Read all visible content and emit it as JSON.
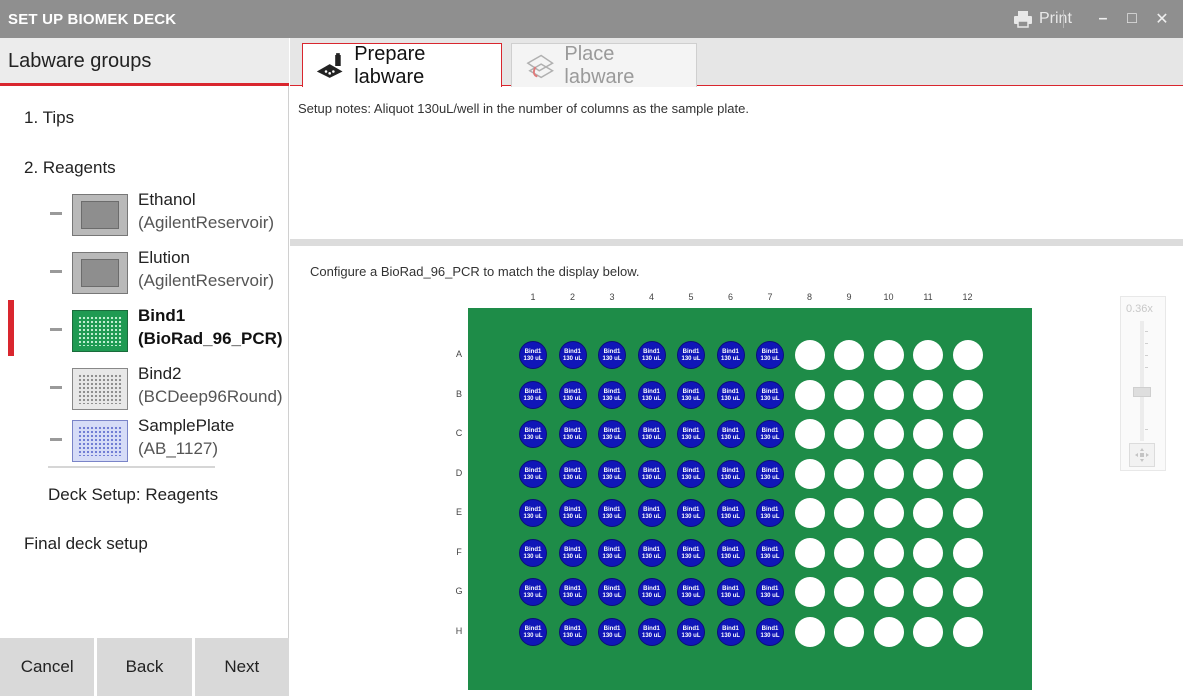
{
  "window": {
    "title": "SET UP BIOMEK DECK",
    "print_label": "Print",
    "minimize": "–",
    "maximize": "□",
    "close": "✕"
  },
  "sidebar": {
    "header": "Labware groups",
    "groups": [
      {
        "label": "1. Tips"
      },
      {
        "label": "2. Reagents"
      }
    ],
    "reagents": [
      {
        "name": "Ethanol",
        "type": "(AgilentReservoir)",
        "thumb": "reservoir",
        "active": false
      },
      {
        "name": "Elution",
        "type": "(AgilentReservoir)",
        "thumb": "reservoir",
        "active": false
      },
      {
        "name": "Bind1",
        "type": "(BioRad_96_PCR)",
        "thumb": "greenplate",
        "active": true
      },
      {
        "name": "Bind2",
        "type": "(BCDeep96Round)",
        "thumb": "greyplate",
        "active": false
      },
      {
        "name": "SamplePlate",
        "type": "(AB_1127)",
        "thumb": "blueplate",
        "active": false
      }
    ],
    "deck_setup_label": "Deck Setup: Reagents",
    "final_label": "Final deck setup",
    "buttons": {
      "cancel": "Cancel",
      "back": "Back",
      "next": "Next"
    }
  },
  "tabs": [
    {
      "label": "Prepare labware",
      "active": true
    },
    {
      "label": "Place labware",
      "active": false
    }
  ],
  "setup_notes": "Setup notes:  Aliquot 130uL/well in the number of columns as the sample plate.",
  "configure_text": "Configure a BioRad_96_PCR to match the display below.",
  "plate": {
    "columns": [
      "1",
      "2",
      "3",
      "4",
      "5",
      "6",
      "7",
      "8",
      "9",
      "10",
      "11",
      "12"
    ],
    "rows": [
      "A",
      "B",
      "C",
      "D",
      "E",
      "F",
      "G",
      "H"
    ],
    "filled_columns": 7,
    "well_label_line1": "Bind1",
    "well_label_line2": "130 uL",
    "plate_color": "#1e8c48",
    "filled_color": "#1016b8"
  },
  "zoom": {
    "value": "0.36x",
    "level": 0.36
  }
}
